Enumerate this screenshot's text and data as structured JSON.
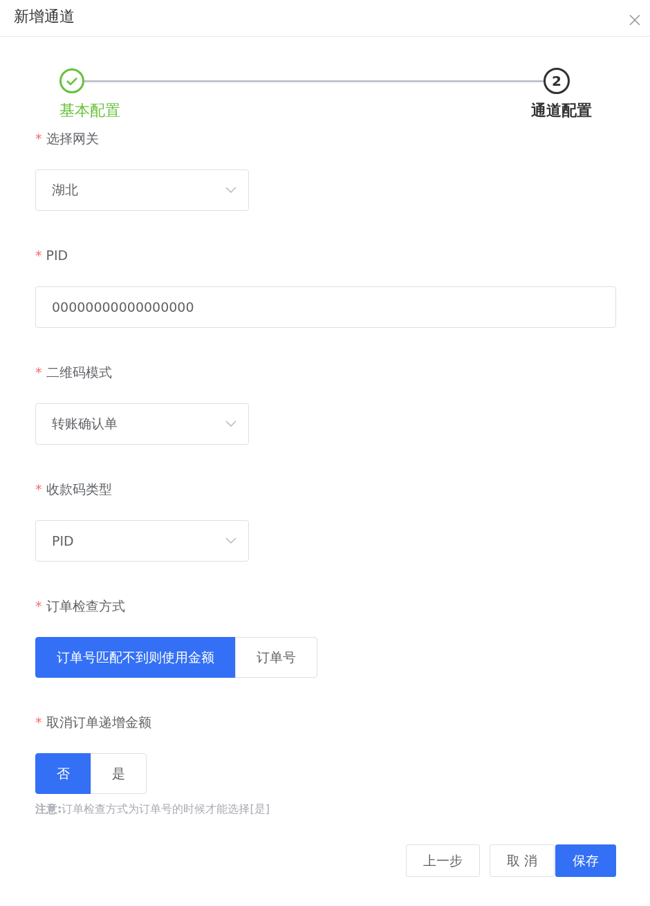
{
  "dialog": {
    "title": "新增通道"
  },
  "steps": [
    {
      "label": "基本配置",
      "completed": true
    },
    {
      "label": "通道配置",
      "completed": false,
      "number": "2"
    }
  ],
  "fields": [
    {
      "label": "选择网关",
      "required_mark": "*",
      "kind": "select",
      "value": "湖北"
    },
    {
      "label": "PID",
      "required_mark": "*",
      "kind": "input",
      "value": "00000000000000000"
    },
    {
      "label": "二维码模式",
      "required_mark": "*",
      "kind": "select",
      "value": "转账确认单"
    },
    {
      "label": "收款码类型",
      "required_mark": "*",
      "kind": "select",
      "value": "PID"
    },
    {
      "label": "订单检查方式",
      "required_mark": "*",
      "kind": "segmented",
      "options": [
        {
          "label": "订单号匹配不到则使用金额",
          "selected": true
        },
        {
          "label": "订单号",
          "selected": false
        }
      ]
    },
    {
      "label": "取消订单递增金额",
      "required_mark": "*",
      "kind": "segmented",
      "options": [
        {
          "label": "否",
          "selected": true
        },
        {
          "label": "是",
          "selected": false
        }
      ],
      "note": "**注意:**订单检查方式为订单号的时候才能选择[是]"
    }
  ],
  "buttons": [
    {
      "label": "上一步",
      "primary": false
    },
    {
      "label": "取 消",
      "primary": false
    },
    {
      "label": "保存",
      "primary": true
    }
  ]
}
